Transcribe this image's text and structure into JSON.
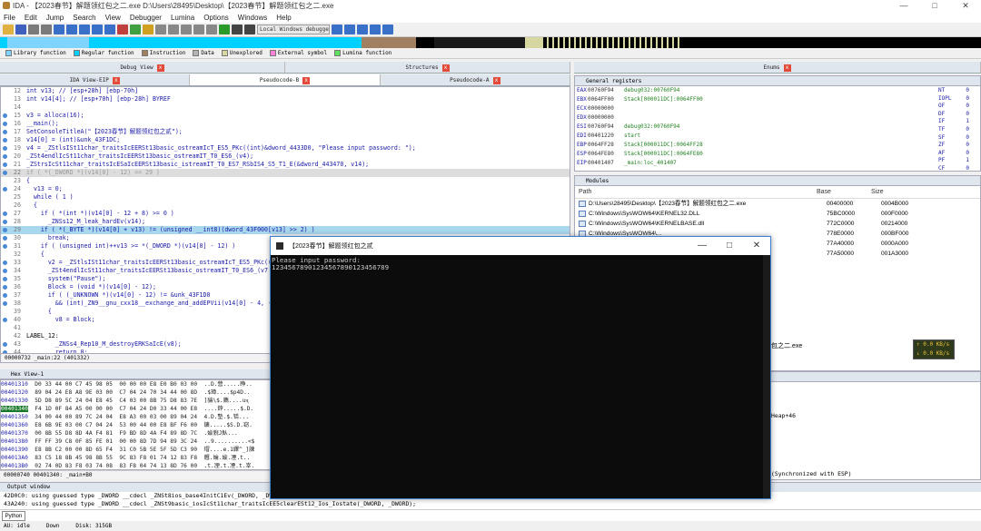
{
  "window": {
    "title": "IDA - 【2023春节】解题领红包之二.exe D:\\Users\\28495\\Desktop\\【2023春节】解题领红包之二.exe"
  },
  "menu": [
    "File",
    "Edit",
    "Jump",
    "Search",
    "View",
    "Debugger",
    "Lumina",
    "Options",
    "Windows",
    "Help"
  ],
  "toolbar": {
    "debugger_select": "Local Windows debugger"
  },
  "legend": [
    "Library function",
    "Regular function",
    "Instruction",
    "Data",
    "Unexplored",
    "External symbol",
    "Lumina function"
  ],
  "legend_colors": [
    "#7fd4ff",
    "#00d0ff",
    "#a08060",
    "#b4b4b4",
    "#d6d6a0",
    "#ff80d8",
    "#60e060"
  ],
  "tabs": {
    "left_top": "Debug View",
    "ida_view": "IDA View-EIP",
    "pseudo_b": "Pseudocode-B",
    "pseudo_a": "Pseudocode-A",
    "structures": "Structures",
    "enums": "Enums"
  },
  "pseudocode": [
    {
      "n": "12",
      "t": "int v13; // [esp+28h] [ebp-70h]",
      "s": ""
    },
    {
      "n": "13",
      "t": "int v14[4]; // [esp+70h] [ebp-28h] BYREF",
      "s": ""
    },
    {
      "n": "14",
      "t": "",
      "s": ""
    },
    {
      "n": "15",
      "t": "v3 = alloca(16);",
      "s": "dot"
    },
    {
      "n": "16",
      "t": "__main();",
      "s": "dot"
    },
    {
      "n": "17",
      "t": "SetConsoleTitleA(\"【2023春节】解题领红包之贰\");",
      "s": "dot"
    },
    {
      "n": "18",
      "t": "v14[0] = (int)&unk_43F1DC;",
      "s": "dot"
    },
    {
      "n": "19",
      "t": "v4 = _ZStlsISt11char_traitsIcEERSt13basic_ostreamIcT_ES5_PKc((int)&dword_4433D0, \"Please input password: \");",
      "s": "dot"
    },
    {
      "n": "20",
      "t": "_ZSt4endlIcSt11char_traitsIcEERSt13basic_ostreamIT_T0_ES6_(v4);",
      "s": "dot"
    },
    {
      "n": "21",
      "t": "_ZStrsIcSt11char_traitsIcESaIcEERSt13basic_istreamIT_T0_ES7_RSbIS4_S5_T1_E(&dword_443470, v14);",
      "s": "dot"
    },
    {
      "n": "22",
      "t": "if ( *(_DWORD *)(v14[0] - 12) == 29 )",
      "s": "gry"
    },
    {
      "n": "23",
      "t": "{",
      "s": ""
    },
    {
      "n": "24",
      "t": "  v13 = 0;",
      "s": "dot"
    },
    {
      "n": "25",
      "t": "  while ( 1 )",
      "s": ""
    },
    {
      "n": "26",
      "t": "  {",
      "s": ""
    },
    {
      "n": "27",
      "t": "    if ( *(int *)(v14[0] - 12 + 8) >= 0 )",
      "s": "dot"
    },
    {
      "n": "28",
      "t": "      _ZNSs12_M_leak_hardEv(v14);",
      "s": "dot"
    },
    {
      "n": "29",
      "t": "    if ( *(_BYTE *)(v14[0] + v13) != (unsigned __int8)(dword_43F000[v13] >> 2) )",
      "s": "hl"
    },
    {
      "n": "30",
      "t": "      break;",
      "s": "dot"
    },
    {
      "n": "31",
      "t": "    if ( (unsigned int)++v13 >= *(_DWORD *)(v14[0] - 12) )",
      "s": "dot"
    },
    {
      "n": "32",
      "t": "    {",
      "s": ""
    },
    {
      "n": "33",
      "t": "      v2 = _ZStlsISt11char_traitsIcEERSt13basic_ostreamIcT_ES5_PKc((",
      "s": "dot"
    },
    {
      "n": "34",
      "t": "      _ZSt4endlIcSt11char_traitsIcEERSt13basic_ostreamIT_T0_ES6_(v7",
      "s": "dot"
    },
    {
      "n": "35",
      "t": "      system(\"Pause\");",
      "s": "dot"
    },
    {
      "n": "36",
      "t": "      Block = (void *)(v14[0] - 12);",
      "s": "dot"
    },
    {
      "n": "37",
      "t": "      if ( (_UNKNOWN *)(v14[0] - 12) != &unk_43F1D0",
      "s": "dot"
    },
    {
      "n": "38",
      "t": "        && (int)_ZN9__gnu_cxx18__exchange_and_addEPVii(v14[0] - 4, -",
      "s": "dot"
    },
    {
      "n": "39",
      "t": "      {",
      "s": ""
    },
    {
      "n": "40",
      "t": "        v8 = Block;",
      "s": "dot"
    },
    {
      "n": "41",
      "t": "",
      "s": ""
    },
    {
      "n": "42",
      "t": "LABEL_12:",
      "s": "label"
    },
    {
      "n": "43",
      "t": "        _ZNSs4_Rep10_M_destroyERKSaIcE(v8);",
      "s": "dot"
    },
    {
      "n": "44",
      "t": "        return 0;",
      "s": "dot"
    },
    {
      "n": "45",
      "t": "      }",
      "s": ""
    },
    {
      "n": "46",
      "t": "      return 0;",
      "s": "dot"
    }
  ],
  "pseudo_status": "00000732 _main:22 (401332)",
  "registers_title": "General registers",
  "registers": [
    {
      "r": "EAX",
      "v": "00760F94",
      "c": "debug032:00760F94"
    },
    {
      "r": "EBX",
      "v": "0064FF00",
      "c": "Stack[000011DC]:0064FF00"
    },
    {
      "r": "ECX",
      "v": "00000000",
      "c": ""
    },
    {
      "r": "EDX",
      "v": "00000000",
      "c": ""
    },
    {
      "r": "ESI",
      "v": "00760F94",
      "c": "debug032:00760F94"
    },
    {
      "r": "EDI",
      "v": "00401220",
      "c": "start"
    },
    {
      "r": "EBP",
      "v": "0064FF28",
      "c": "Stack[000011DC]:0064FF28"
    },
    {
      "r": "ESP",
      "v": "0064FE80",
      "c": "Stack[000011DC]:0064FE80"
    },
    {
      "r": "EIP",
      "v": "00401407",
      "c": "_main:loc_401407"
    }
  ],
  "flags": [
    [
      "NT",
      "0"
    ],
    [
      "IOPL",
      "0"
    ],
    [
      "OF",
      "0"
    ],
    [
      "DF",
      "0"
    ],
    [
      "IF",
      "1"
    ],
    [
      "TF",
      "0"
    ],
    [
      "SF",
      "0"
    ],
    [
      "ZF",
      "0"
    ],
    [
      "AF",
      "0"
    ],
    [
      "PF",
      "1"
    ],
    [
      "CF",
      "0"
    ]
  ],
  "modules_title": "Modules",
  "modules_header": {
    "path": "Path",
    "base": "Base",
    "size": "Size"
  },
  "modules": [
    {
      "path": "D:\\Users\\28495\\Desktop\\【2023春节】解题领红包之二.exe",
      "base": "00400000",
      "size": "0004B000"
    },
    {
      "path": "C:\\Windows\\SysWOW64\\KERNEL32.DLL",
      "base": "75BC0000",
      "size": "000F0000"
    },
    {
      "path": "C:\\Windows\\SysWOW64\\KERNELBASE.dll",
      "base": "772C0000",
      "size": "00214000"
    },
    {
      "path": "C:\\Windows\\SysWOW64\\...",
      "base": "778E0000",
      "size": "000BF000"
    },
    {
      "path": "",
      "base": "77A40000",
      "size": "0000A000"
    },
    {
      "path": "",
      "base": "77A50000",
      "size": "001A3000"
    }
  ],
  "modules_partial": "包之二.exe",
  "hex_title": "Hex View-1",
  "hex": [
    {
      "a": "00401310",
      "b": "D0 33 44 00 C7 45 98 05  00 00 00 E8 E0 B0 03 00",
      "s": "..D.營.....睁.."
    },
    {
      "a": "00401320",
      "b": "89 04 24 E8 A8 9E 03 00  C7 04 24 70 34 44 00 8D",
      "s": ".$璋....$p4D.."
    },
    {
      "a": "00401330",
      "b": "5D D8 89 5C 24 04 E8 45  C4 03 00 8B 75 D8 83 7E",
      "s": "]貒\\$.鑴....uҷ"
    },
    {
      "a": "00401340",
      "b": "F4 1D 0F 84 A5 00 00 00  C7 04 24 D0 33 44 00 E8",
      "s": "....鋍.....$.D."
    },
    {
      "a": "00401350",
      "b": "34 00 44 00 89 7C 24 04  E8 A3 00 03 00 89 04 24",
      "s": "4.D.墊.$.铦..."
    },
    {
      "a": "00401360",
      "b": "E8 6B 9E 03 00 C7 04 24  53 00 44 00 E8 BF F6 00",
      "s": "鑛.....$S.D.窈."
    },
    {
      "a": "00401370",
      "b": "00 8B 55 D8 8D 4A F4 81  F9 BD 8D 4A F4 89 8D 7C",
      "s": ".婾貎J魜..."
    },
    {
      "a": "00401380",
      "b": "FF FF 39 C8 0F 85 FE 01  00 00 8D 7D 94 89 3C 24",
      "s": "..9..........<$"
    },
    {
      "a": "00401390",
      "b": "E8 8B C2 00 00 8D 65 F4  31 C0 5B 5E 5F 5D C3 90",
      "s": "瑁....e.1繹^_]脨"
    },
    {
      "a": "004013A0",
      "b": "83 C5 18 8B 45 98 8B 55  9C 83 F8 01 74 12 83 F8",
      "s": "兣.婨.婾.凐.t.."
    },
    {
      "a": "004013B0",
      "b": "02 74 0D 83 F8 03 74 08  83 F8 04 74 13 8D 76 00",
      "s": ".t.凐.t.凐.t.峷."
    }
  ],
  "hex_status": "00000740 00401340: _main+B0",
  "stack_partial_1": "Heap+46",
  "stack_partial_2": "(Synchronized with ESP)",
  "output_title": "Output window",
  "output_lines": [
    "42D0C0: using guessed type _DWORD __cdecl _ZNSt8ios_base4InitC1Ev(_DWORD, _DWORD);",
    "43A240: using guessed type _DWORD __cdecl _ZNSt9basic_iosIcSt11char_traitsIcEE5clearESt12_Ios_Iostate(_DWORD, _DWORD);"
  ],
  "python_label": "Python",
  "status": {
    "au": "AU:  idle",
    "dir": "Down",
    "disk": "Disk: 315GB"
  },
  "console": {
    "title": "【2023春节】解题领红包之贰",
    "line1": "Please input password:",
    "line2": "12345678901234567890123456789"
  },
  "network": {
    "up": "↑ 0.0 KB/s",
    "down": "↓ 0.0 KB/s"
  }
}
